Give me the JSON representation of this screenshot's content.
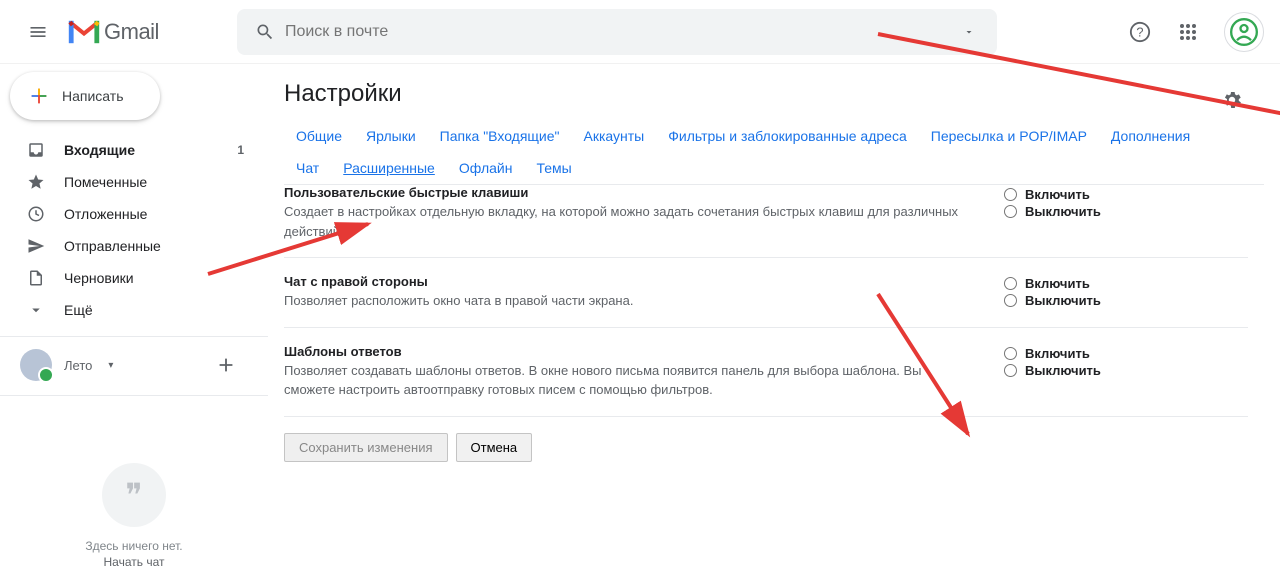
{
  "header": {
    "logo_text": "Gmail",
    "search_placeholder": "Поиск в почте"
  },
  "sidebar": {
    "compose": "Написать",
    "items": [
      {
        "label": "Входящие",
        "count": "1"
      },
      {
        "label": "Помеченные"
      },
      {
        "label": "Отложенные"
      },
      {
        "label": "Отправленные"
      },
      {
        "label": "Черновики"
      },
      {
        "label": "Ещё"
      }
    ],
    "chat_user": "Лето",
    "empty_text1": "Здесь ничего нет.",
    "empty_text2": "Начать чат"
  },
  "page": {
    "title": "Настройки"
  },
  "tabs": {
    "row1": [
      "Общие",
      "Ярлыки",
      "Папка \"Входящие\"",
      "Аккаунты",
      "Фильтры и заблокированные адреса",
      "Пересылка и POP/IMAP",
      "Дополнения"
    ],
    "row2": [
      "Чат",
      "Расширенные",
      "Офлайн",
      "Темы"
    ]
  },
  "radio_labels": {
    "enable": "Включить",
    "disable": "Выключить"
  },
  "settings": [
    {
      "title": "Пользовательские быстрые клавиши",
      "desc": "Создает в настройках отдельную вкладку, на которой можно задать сочетания быстрых клавиш для различных действий."
    },
    {
      "title": "Чат с правой стороны",
      "desc": "Позволяет расположить окно чата в правой части экрана."
    },
    {
      "title": "Шаблоны ответов",
      "desc": "Позволяет создавать шаблоны ответов. В окне нового письма появится панель для выбора шаблона. Вы сможете настроить автоотправку готовых писем с помощью фильтров."
    }
  ],
  "buttons": {
    "save": "Сохранить изменения",
    "cancel": "Отмена"
  }
}
